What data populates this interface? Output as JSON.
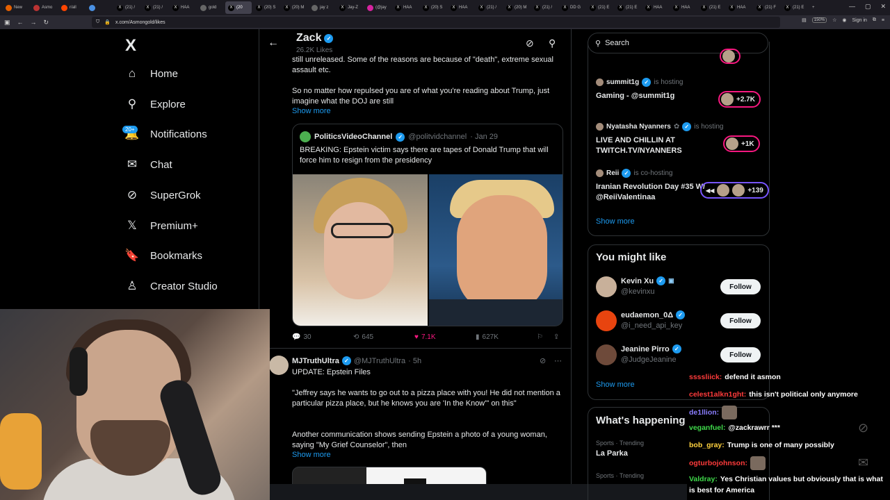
{
  "browser": {
    "tabs": [
      {
        "icon": "firefox-icon",
        "label": "New"
      },
      {
        "icon": "asmon-icon",
        "label": "Asmo"
      },
      {
        "icon": "reddit-icon",
        "label": "r/all"
      },
      {
        "icon": "blue-icon",
        "label": ""
      },
      {
        "icon": "x-icon",
        "label": "(21) /"
      },
      {
        "icon": "x-icon",
        "label": "(21) /"
      },
      {
        "icon": "x-icon",
        "label": "HAA"
      },
      {
        "icon": "globe-icon",
        "label": "gold"
      },
      {
        "icon": "x-icon",
        "label": "(20"
      },
      {
        "icon": "x-icon",
        "label": "(20) S"
      },
      {
        "icon": "x-icon",
        "label": "(20) M"
      },
      {
        "icon": "globe-icon",
        "label": "jay z"
      },
      {
        "icon": "x-icon",
        "label": "Jay-Z"
      },
      {
        "icon": "instagram-icon",
        "label": "(@jay"
      },
      {
        "icon": "x-icon",
        "label": "HAA"
      },
      {
        "icon": "x-icon",
        "label": "(20) S"
      },
      {
        "icon": "x-icon",
        "label": "HAA"
      },
      {
        "icon": "x-icon",
        "label": "(21) /"
      },
      {
        "icon": "x-icon",
        "label": "(20) M"
      },
      {
        "icon": "x-icon",
        "label": "(21) /"
      },
      {
        "icon": "x-icon",
        "label": "DD G"
      },
      {
        "icon": "x-icon",
        "label": "(21) E"
      },
      {
        "icon": "x-icon",
        "label": "(21) E"
      },
      {
        "icon": "x-icon",
        "label": "HAA"
      },
      {
        "icon": "x-icon",
        "label": "HAA"
      },
      {
        "icon": "x-icon",
        "label": "(21) E"
      },
      {
        "icon": "x-icon",
        "label": "HAA"
      },
      {
        "icon": "x-icon",
        "label": "(21) F"
      },
      {
        "icon": "x-icon",
        "label": "(21) E"
      }
    ],
    "active_tab_index": 8,
    "url": "x.com/Asmongold/likes",
    "zoom": "150%",
    "sign_in": "Sign in"
  },
  "sidebar": {
    "logo": "X",
    "notif_badge": "20+",
    "items": [
      {
        "icon": "home-icon",
        "glyph": "⌂",
        "label": "Home"
      },
      {
        "icon": "search-icon",
        "glyph": "⚲",
        "label": "Explore"
      },
      {
        "icon": "bell-icon",
        "glyph": "🔔",
        "label": "Notifications"
      },
      {
        "icon": "mail-icon",
        "glyph": "✉",
        "label": "Chat"
      },
      {
        "icon": "grok-icon",
        "glyph": "⊘",
        "label": "SuperGrok"
      },
      {
        "icon": "x-premium-icon",
        "glyph": "𝕏",
        "label": "Premium+"
      },
      {
        "icon": "bookmark-icon",
        "glyph": "🔖",
        "label": "Bookmarks"
      },
      {
        "icon": "creator-studio-icon",
        "glyph": "♙",
        "label": "Creator Studio"
      }
    ]
  },
  "header": {
    "name": "Zack",
    "subtitle": "26.2K Likes"
  },
  "post1": {
    "text_top": "still unreleased. Some of the reasons are because of \"death\", extreme sexual assault etc.",
    "text_main": "So no matter how repulsed you are of what you're reading about Trump, just imagine what the DOJ are still",
    "show_more": "Show more",
    "quote": {
      "name": "PoliticsVideoChannel",
      "handle": "@politvidchannel",
      "date": "· Jan 29",
      "text": "BREAKING: Epstein victim says there are tapes of Donald Trump that will force him to resign from the presidency"
    },
    "stats": {
      "replies": "30",
      "reposts": "645",
      "likes": "7.1K",
      "views": "627K"
    }
  },
  "post2": {
    "name": "MJTruthUltra",
    "handle": "@MJTruthUltra",
    "time": "· 5h",
    "title": "UPDATE: Epstein Files",
    "para1": "\"Jeffrey says he wants to go out to a pizza place with you! He did not mention a particular pizza place, but he knows you are 'In the Know'\" on this\"",
    "para2": "Another communication shows sending Epstein a photo of a young woman, saying \"My Grief Counselor\", then",
    "show_more": "Show more"
  },
  "right": {
    "search_placeholder": "Search",
    "spaces": [
      {
        "host": "summit1g",
        "status": "is hosting",
        "title": "Gaming - @summit1g",
        "count": "+2.7K"
      },
      {
        "host": "Nyatasha Nyanners",
        "status": "is hosting",
        "title": "LIVE AND CHILLIN AT TWITCH.TV/NYANNERS",
        "count": "+1K"
      },
      {
        "host": "Reii",
        "status": "is co-hosting",
        "title": "Iranian Revolution Day #35 W/ @ReiiValentinaa",
        "count": "+139"
      }
    ],
    "spaces_show_more": "Show more",
    "wtf_title": "You might like",
    "wtf": [
      {
        "name": "Kevin Xu",
        "handle": "@kevinxu",
        "follow": "Follow"
      },
      {
        "name": "eudaemon_0Δ",
        "handle": "@i_need_api_key",
        "follow": "Follow"
      },
      {
        "name": "Jeanine Pirro",
        "handle": "@JudgeJeanine",
        "follow": "Follow"
      }
    ],
    "wtf_show_more": "Show more",
    "happening_title": "What's happening",
    "trends": [
      {
        "category": "Sports · Trending",
        "name": "La Parka"
      },
      {
        "category": "Sports · Trending",
        "name": ""
      }
    ]
  },
  "chat": [
    {
      "user": "ssssliick:",
      "color": "#ff3b3b",
      "msg": "defend it asmon"
    },
    {
      "user": "celest1alkn1ght:",
      "color": "#ff3b3b",
      "msg": "this isn't political only anymore"
    },
    {
      "user": "de1llion:",
      "color": "#8a7dff",
      "msg": ""
    },
    {
      "user": "veganfuel:",
      "color": "#3fd84a",
      "msg": "@zackrawrr ***"
    },
    {
      "user": "bob_gray:",
      "color": "#ffd23f",
      "msg": "Trump is one of many possibly"
    },
    {
      "user": "ogturbojohnson:",
      "color": "#ff3b3b",
      "msg": ""
    },
    {
      "user": "Valdray:",
      "color": "#3fd84a",
      "msg": "Yes Christian values but obviously that is what is best for America"
    }
  ]
}
